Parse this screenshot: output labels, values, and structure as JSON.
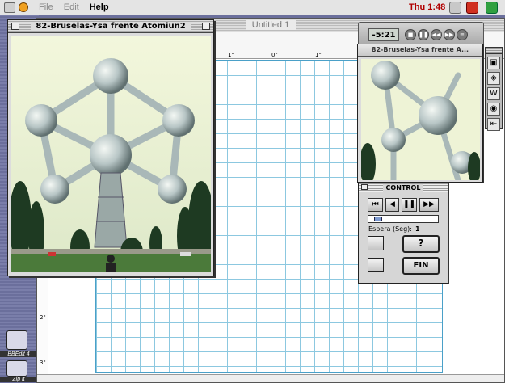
{
  "menubar": {
    "items": [
      "File",
      "Edit",
      "Help"
    ],
    "clock": "Thu 1:48"
  },
  "document": {
    "title": "Untitled 1",
    "ruler_top_labels": [
      "1\"",
      "0\"",
      "1\""
    ],
    "ruler_left_labels": [
      "2\"",
      "3\""
    ]
  },
  "photo_window": {
    "title": "82-Bruselas-Ysa frente Atomiun2"
  },
  "preview_window": {
    "title": "82-Bruselas-Ysa frente A..."
  },
  "player": {
    "time": "-5:21",
    "buttons": [
      "stop",
      "pause",
      "rewind",
      "forward",
      "menu"
    ]
  },
  "control_panel": {
    "title": "CONTROL",
    "espera_label": "Espera (Seg):",
    "espera_value": "1",
    "help_label": "?",
    "fin_label": "FIN",
    "nav_buttons": [
      "first",
      "previous",
      "pause",
      "next"
    ]
  },
  "desktop": {
    "icons": [
      {
        "label": "BBEdit 4"
      },
      {
        "label": "Zip it"
      }
    ]
  },
  "colors": {
    "clock": "#b00000",
    "grid": "#8cc8e0",
    "desktop": "#6b6f9c"
  }
}
